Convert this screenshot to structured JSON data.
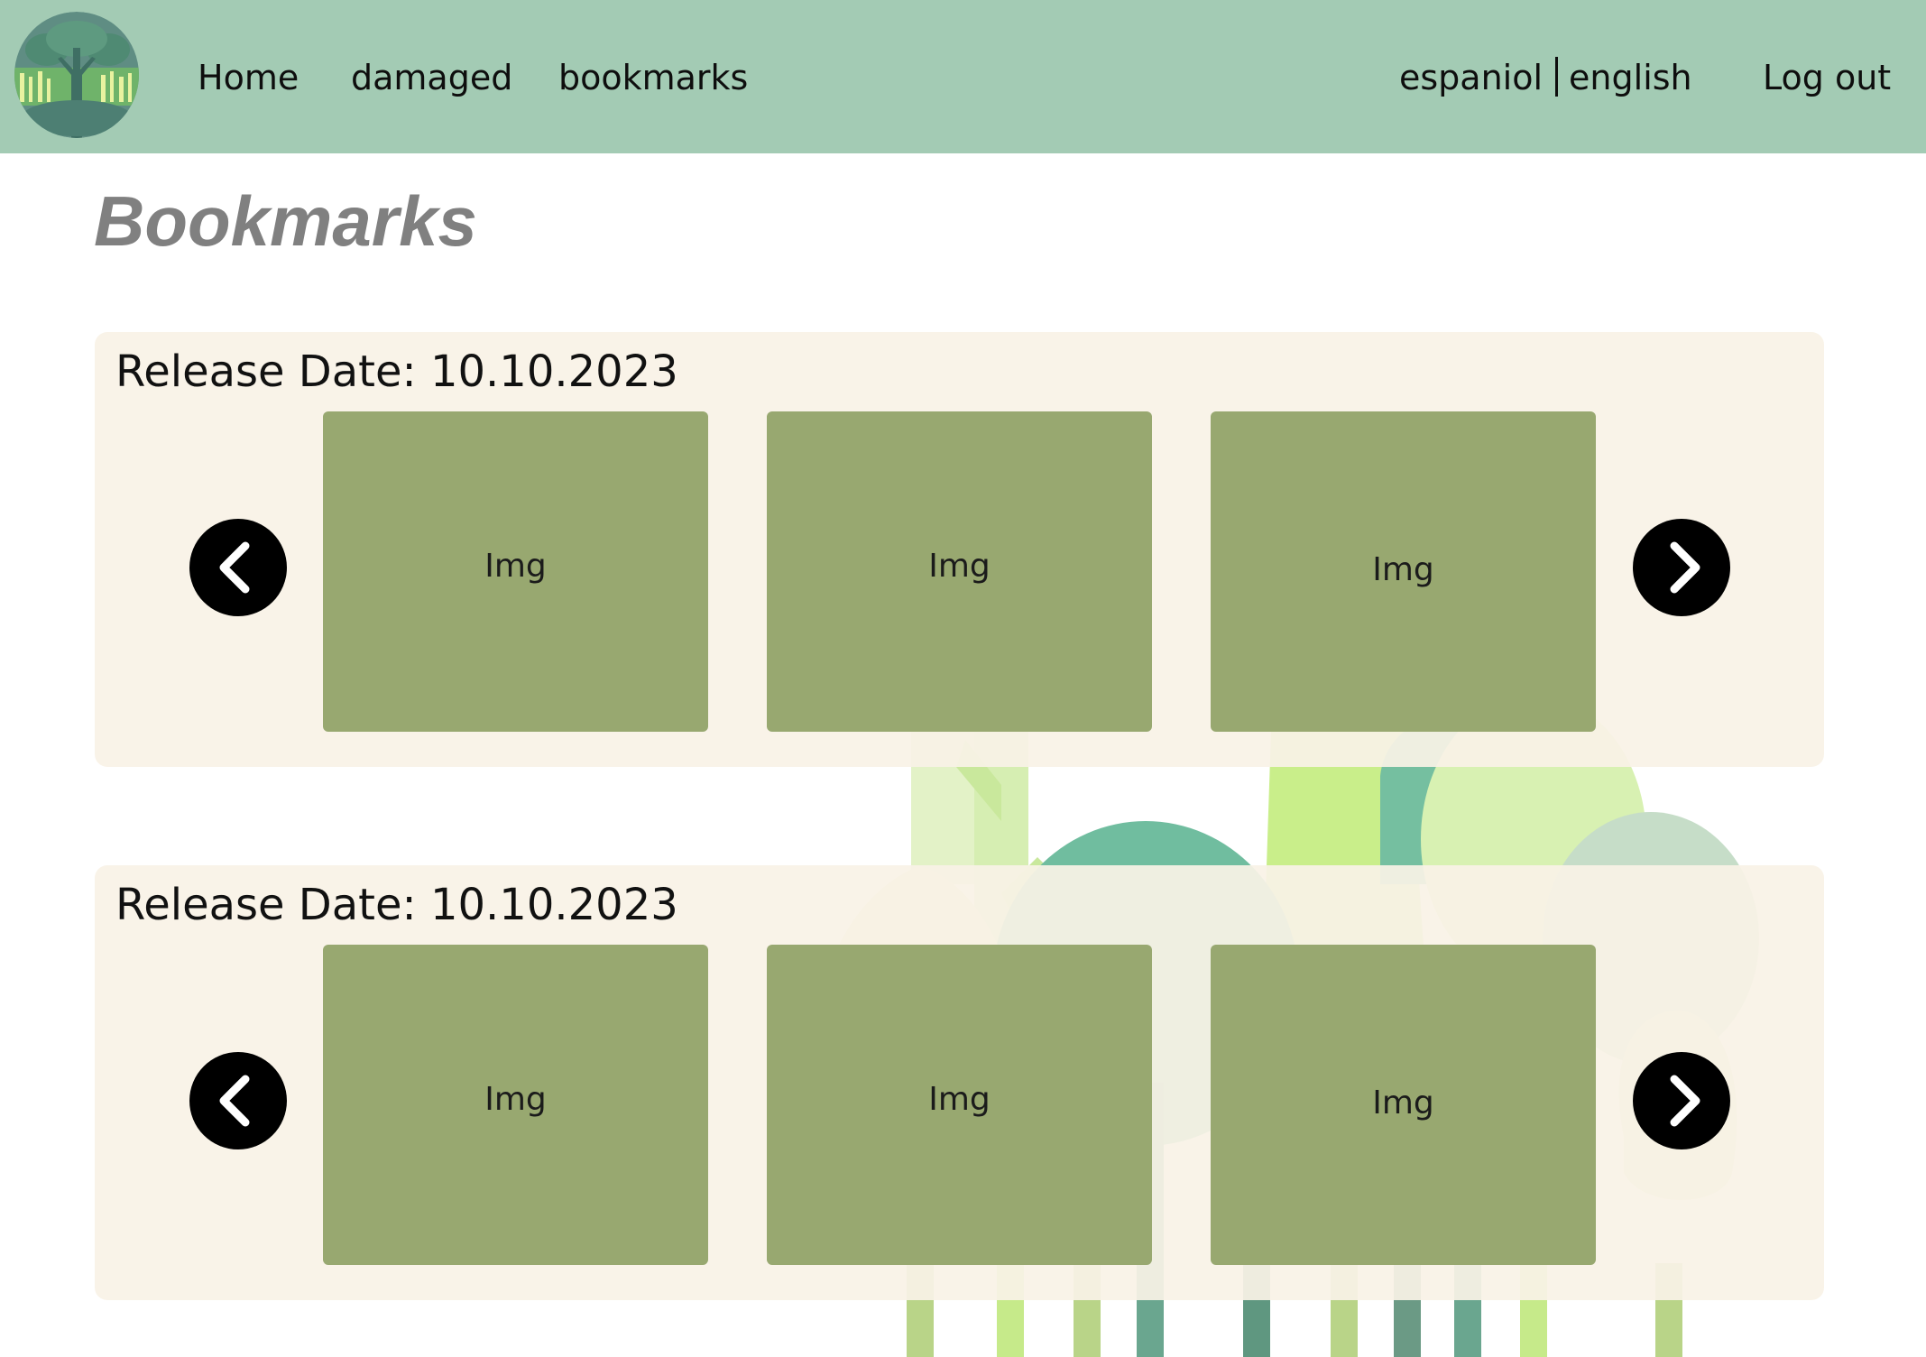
{
  "header": {
    "nav": [
      {
        "label": "Home"
      },
      {
        "label": "damaged"
      },
      {
        "label": "bookmarks"
      }
    ],
    "language": {
      "option_1": "espaniol",
      "option_2": "english"
    },
    "logout_label": "Log out",
    "logo_icon": "forest-tree-logo-icon"
  },
  "main": {
    "title": "Bookmarks",
    "sections": [
      {
        "release_label": "Release Date: 10.10.2023",
        "cards": [
          {
            "label": "Img"
          },
          {
            "label": "Img"
          },
          {
            "label": "Img"
          }
        ],
        "prev_icon": "chevron-left-icon",
        "next_icon": "chevron-right-icon"
      },
      {
        "release_label": "Release Date: 10.10.2023",
        "cards": [
          {
            "label": "Img"
          },
          {
            "label": "Img"
          },
          {
            "label": "Img"
          }
        ],
        "prev_icon": "chevron-left-icon",
        "next_icon": "chevron-right-icon"
      }
    ]
  },
  "colors": {
    "header_bg": "#a3cbb4",
    "section_bg": "#f9f2e6",
    "card_bg": "#98a870",
    "title": "#808080",
    "arrow_bg": "#000000"
  }
}
